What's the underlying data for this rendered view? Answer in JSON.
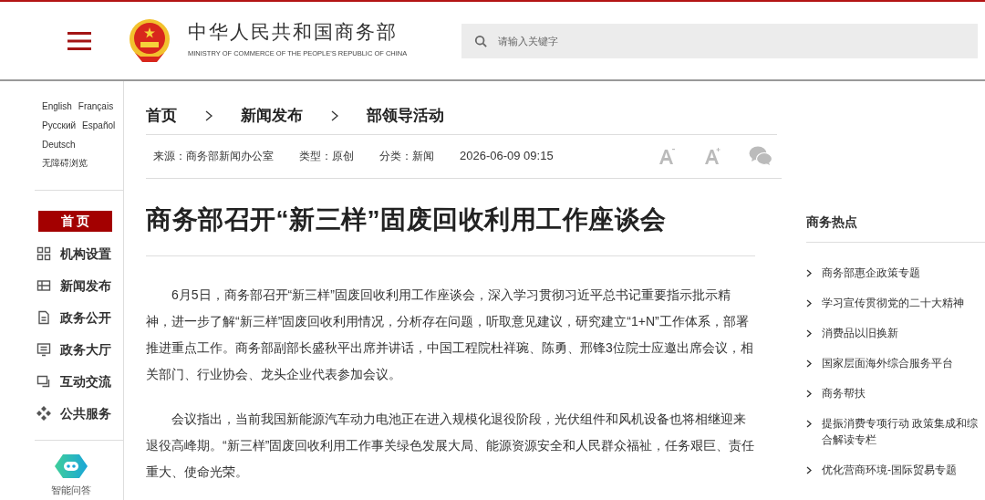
{
  "header": {
    "title": "中华人民共和国商务部",
    "subtitle": "MINISTRY OF COMMERCE OF THE PEOPLE'S REPUBLIC OF CHINA",
    "search": {
      "placeholder": "请输入关键字"
    }
  },
  "sidebar": {
    "languages": [
      [
        "English",
        "Français"
      ],
      [
        "Русский",
        "Español"
      ],
      [
        "Deutsch"
      ]
    ],
    "accessibility": "无障碍浏览",
    "items": [
      {
        "label": "首 页",
        "kind": "home",
        "selected": true
      },
      {
        "label": "机构设置",
        "kind": "grid",
        "selected": false
      },
      {
        "label": "新闻发布",
        "kind": "news",
        "selected": false
      },
      {
        "label": "政务公开",
        "kind": "doc",
        "selected": false
      },
      {
        "label": "政务大厅",
        "kind": "monitor",
        "selected": false
      },
      {
        "label": "互动交流",
        "kind": "chat",
        "selected": false
      },
      {
        "label": "公共服务",
        "kind": "service",
        "selected": false
      }
    ],
    "assistant": "智能问答"
  },
  "breadcrumb": [
    "首页",
    "新闻发布",
    "部领导活动"
  ],
  "meta": [
    "来源：商务部新闻办公室",
    "类型：原创",
    "分类：新闻",
    "2026-06-09 09:15"
  ],
  "article": {
    "title": "商务部召开“新三样”固废回收利用工作座谈会",
    "paragraphs": [
      "6月5日，商务部召开“新三样”固废回收利用工作座谈会，深入学习贯彻习近平总书记重要指示批示精神，进一步了解“新三样”固废回收利用情况，分析存在问题，听取意见建议，研究建立“1+N”工作体系，部署推进重点工作。商务部副部长盛秋平出席并讲话，中国工程院杜祥琬、陈勇、邢锋3位院士应邀出席会议，相关部门、行业协会、龙头企业代表参加会议。",
      "会议指出，当前我国新能源汽车动力电池正在进入规模化退役阶段，光伏组件和风机设备也将相继迎来退役高峰期。“新三样”固废回收利用工作事关绿色发展大局、能源资源安全和人民群众福祉，任务艰巨、责任重大、使命光荣。"
    ]
  },
  "hot": {
    "title": "商务热点",
    "items": [
      "商务部惠企政策专题",
      "学习宣传贯彻党的二十大精神",
      "消费品以旧换新",
      "国家层面海外综合服务平台",
      "商务帮扶",
      "提振消费专项行动 政策集成和综合解读专栏",
      "优化营商环境-国际贸易专题"
    ]
  }
}
